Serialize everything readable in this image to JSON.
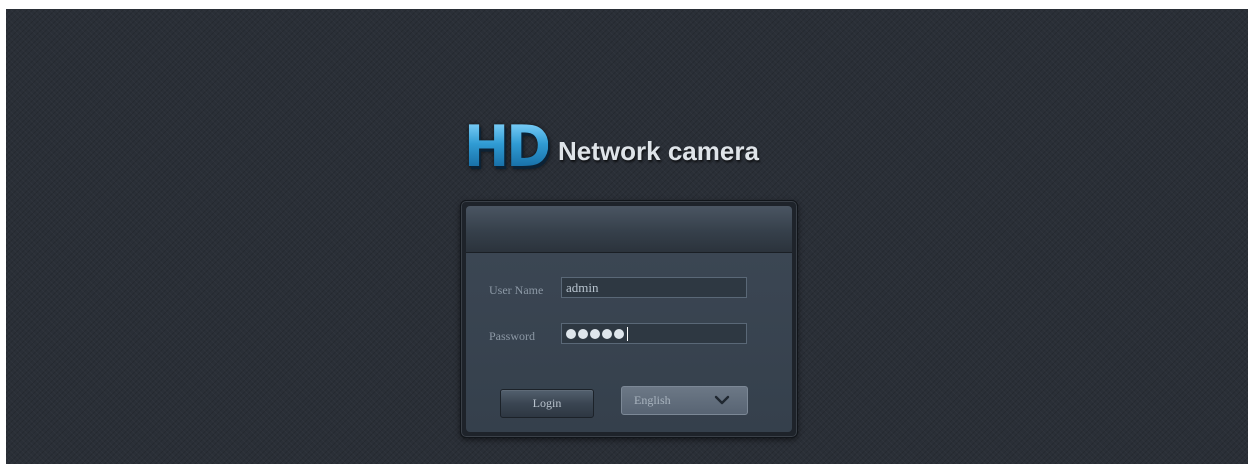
{
  "logo": {
    "hd_text": "HD",
    "title": "Network camera"
  },
  "login_form": {
    "username_label": "User Name",
    "username_value": "admin",
    "password_label": "Password",
    "password_masked_length": 5,
    "login_button": "Login",
    "language": {
      "selected": "English"
    }
  },
  "icons": {
    "dropdown": "chevron-down-icon"
  },
  "colors": {
    "background": "#2a2f37",
    "logo_accent": "#3aa3d8",
    "panel_body": "#3b4653"
  }
}
